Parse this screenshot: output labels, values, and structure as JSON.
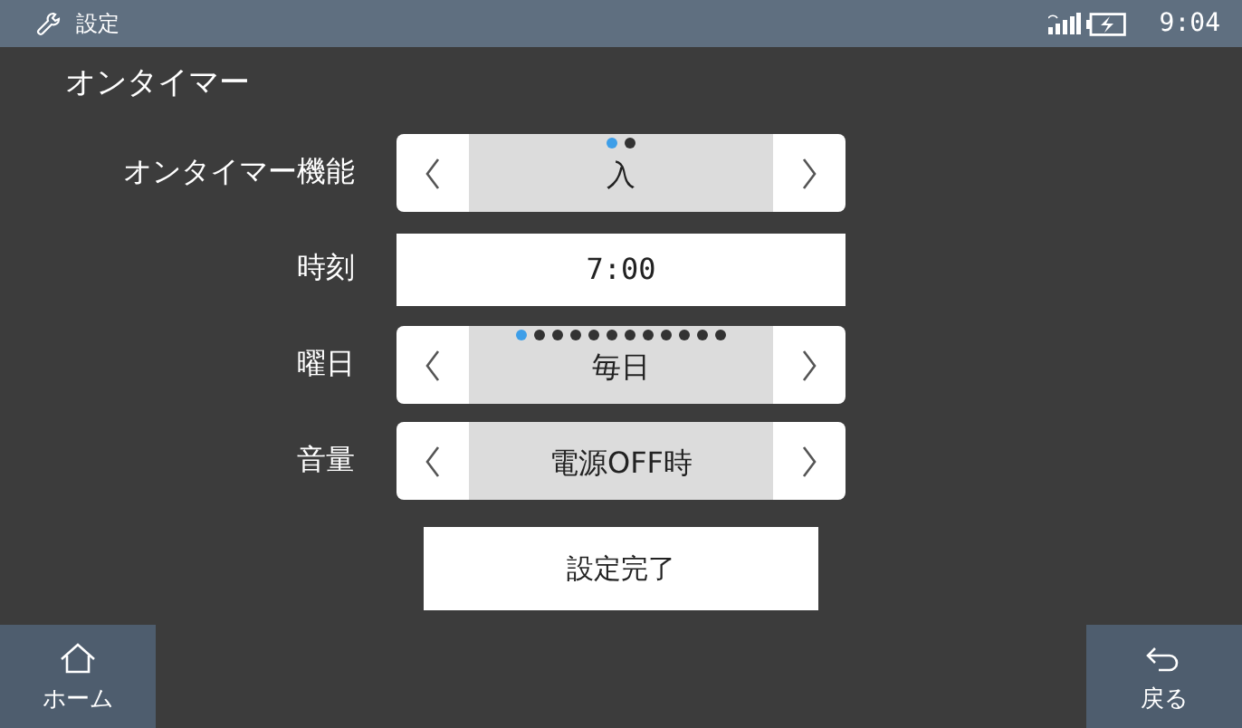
{
  "status_bar": {
    "title": "設定",
    "time": "9:04"
  },
  "heading": "オンタイマー",
  "settings": [
    {
      "kind": "spinner",
      "label": "オンタイマー機能",
      "value": "入",
      "dots": [
        {
          "selected": true
        },
        {
          "selected": false
        }
      ]
    },
    {
      "kind": "field",
      "label": "時刻",
      "value": "7:00"
    },
    {
      "kind": "spinner",
      "label": "曜日",
      "value": "毎日",
      "dots": [
        {
          "selected": true
        },
        {
          "selected": false
        },
        {
          "selected": false
        },
        {
          "selected": false
        },
        {
          "selected": false
        },
        {
          "selected": false
        },
        {
          "selected": false
        },
        {
          "selected": false
        },
        {
          "selected": false
        },
        {
          "selected": false
        },
        {
          "selected": false
        },
        {
          "selected": false
        }
      ]
    },
    {
      "kind": "spinner",
      "label": "音量",
      "value": "電源OFF時"
    }
  ],
  "done_button": "設定完了",
  "nav": {
    "home": "ホーム",
    "back": "戻る"
  }
}
